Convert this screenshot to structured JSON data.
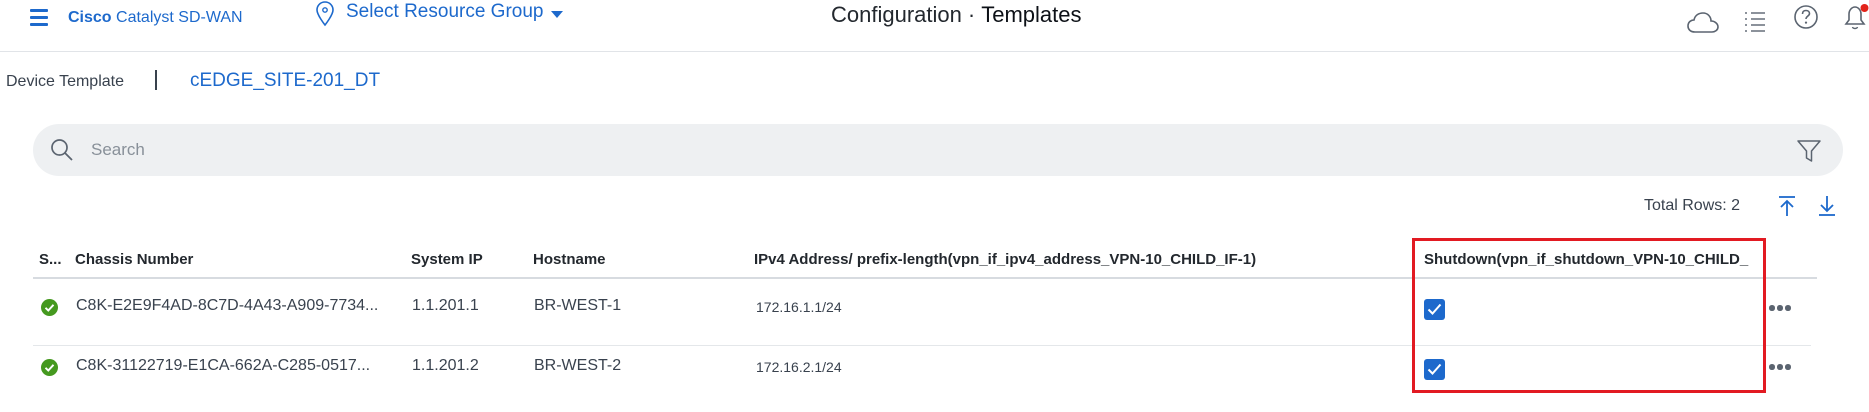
{
  "header": {
    "brand_bold": "Cisco",
    "brand_rest": "Catalyst SD-WAN",
    "resource_group": "Select Resource Group",
    "title_section": "Configuration",
    "title_separator": "·",
    "title_page": "Templates",
    "icons": [
      "menu-icon",
      "location-pin-icon",
      "caret-down-icon",
      "cloud-icon",
      "tasks-list-icon",
      "help-icon",
      "notification-bell-icon"
    ]
  },
  "breadcrumb": {
    "parent": "Device Template",
    "current": "cEDGE_SITE-201_DT"
  },
  "search": {
    "placeholder": "Search",
    "value": ""
  },
  "table_meta": {
    "total_rows_label": "Total Rows: 2"
  },
  "table": {
    "columns": [
      "S...",
      "Chassis Number",
      "System IP",
      "Hostname",
      "IPv4 Address/ prefix-length(vpn_if_ipv4_address_VPN-10_CHILD_IF-1)",
      "Shutdown(vpn_if_shutdown_VPN-10_CHILD_"
    ],
    "rows": [
      {
        "status": "success",
        "chassis": "C8K-E2E9F4AD-8C7D-4A43-A909-7734...",
        "system_ip": "1.1.201.1",
        "hostname": "BR-WEST-1",
        "ipv4": "172.16.1.1/24",
        "shutdown": true
      },
      {
        "status": "success",
        "chassis": "C8K-31122719-E1CA-662A-C285-0517...",
        "system_ip": "1.1.201.2",
        "hostname": "BR-WEST-2",
        "ipv4": "172.16.2.1/24",
        "shutdown": true
      }
    ]
  },
  "colors": {
    "accent": "#1d69cc",
    "success": "#45991f",
    "highlight": "#e21a22",
    "notification": "#e2231a"
  }
}
